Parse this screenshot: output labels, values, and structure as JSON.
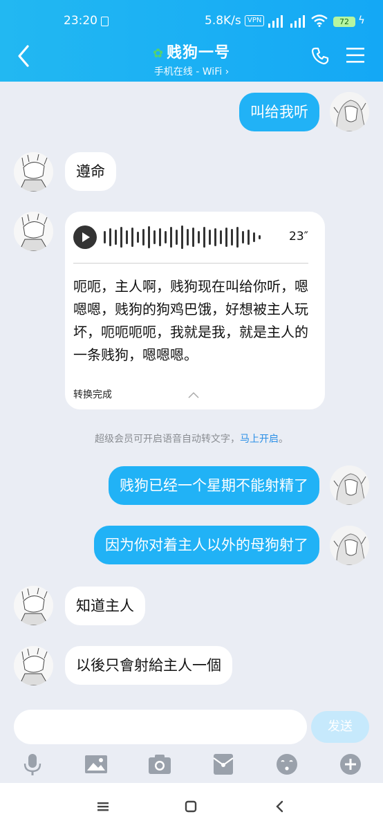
{
  "status_bar": {
    "time": "23:20",
    "network_speed": "5.8K/s",
    "vpn": "VPN",
    "battery": "72"
  },
  "header": {
    "contact_name": "贱狗一号",
    "subtitle": "手机在线 - WiFi",
    "subtitle_chevron": "›",
    "icons": [
      "back-icon",
      "phone-icon",
      "menu-icon"
    ]
  },
  "messages": [
    {
      "side": "me",
      "text": "叫给我听"
    },
    {
      "side": "other",
      "text": "遵命"
    },
    {
      "side": "other",
      "type": "voice",
      "duration": "23″",
      "transcript": "呃呃，主人啊，贱狗现在叫给你听，嗯嗯嗯，贱狗的狗鸡巴饿，好想被主人玩坏，呃呃呃呃，我就是我，就是主人的一条贱狗，嗯嗯嗯。",
      "status": "转换完成"
    },
    {
      "side": "me",
      "text": "贱狗已经一个星期不能射精了"
    },
    {
      "side": "me",
      "text": "因为你对着主人以外的母狗射了"
    },
    {
      "side": "other",
      "text": "知道主人"
    },
    {
      "side": "other",
      "text": "以後只會射給主人一個"
    }
  ],
  "notice": {
    "text": "超级会员可开启语音自动转文字，",
    "link": "马上开启",
    "end": "。"
  },
  "composer": {
    "input_value": "",
    "send_label": "发送"
  },
  "toolbar": [
    "mic-icon",
    "image-icon",
    "camera-icon",
    "red-packet-icon",
    "emoji-icon",
    "plus-icon"
  ],
  "colors": {
    "header": "#1aaff3",
    "my_bubble": "#21b2f6",
    "background": "#eaedf4",
    "link": "#2a8fe6"
  }
}
